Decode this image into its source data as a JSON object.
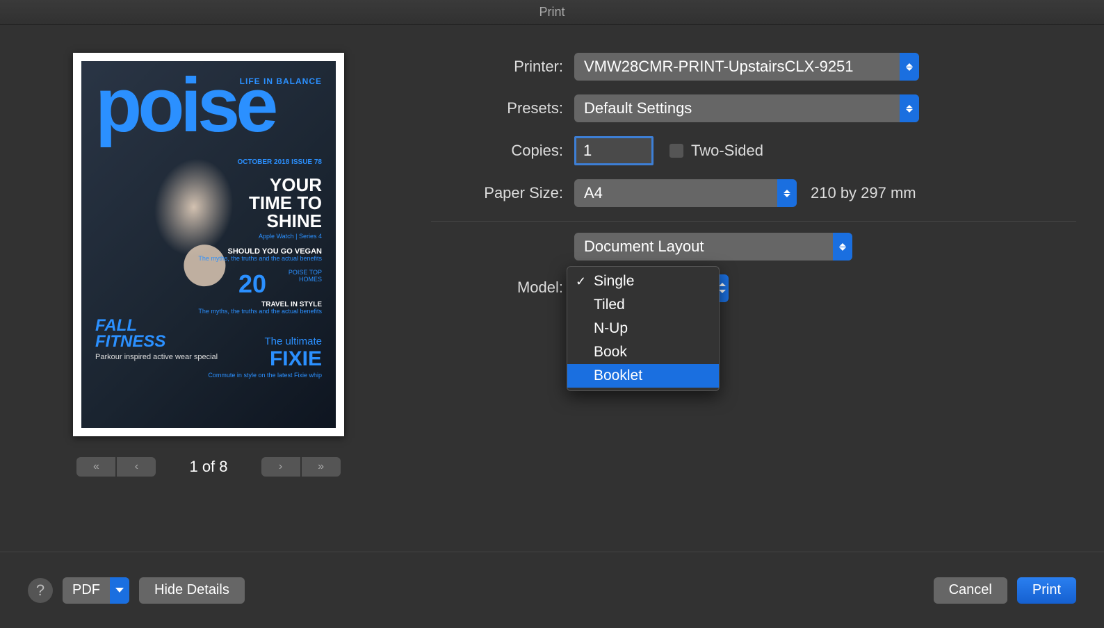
{
  "window": {
    "title": "Print"
  },
  "preview": {
    "page_indicator": "1 of 8",
    "cover": {
      "tagline": "LIFE IN BALANCE",
      "title": "poise",
      "issue": "OCTOBER 2018 ISSUE 78",
      "headline_l1": "YOUR",
      "headline_l2": "TIME TO",
      "headline_l3": "SHINE",
      "watch": "Apple Watch | Series 4",
      "vegan_h": "SHOULD YOU GO VEGAN",
      "vegan_s": "The myths, the truths and the actual benefits",
      "bignum": "20",
      "homes": "POISE TOP HOMES",
      "travel_h": "TRAVEL IN STYLE",
      "travel_s": "The myths, the truths and the actual benefits",
      "ultimate": "The ultimate",
      "fixie": "FIXIE",
      "fixie_s": "Commute in style on the latest Fixie whip",
      "fall_l1": "FALL",
      "fall_l2": "FITNESS",
      "fall_sub": "Parkour inspired active wear special"
    }
  },
  "labels": {
    "printer": "Printer:",
    "presets": "Presets:",
    "copies": "Copies:",
    "two_sided": "Two-Sided",
    "paper_size": "Paper Size:",
    "mode": "Model:"
  },
  "values": {
    "printer": "VMW28CMR-PRINT-UpstairsCLX-9251",
    "presets": "Default Settings",
    "copies": "1",
    "two_sided_checked": false,
    "paper_size": "A4",
    "paper_dim": "210 by 297 mm",
    "section": "Document Layout"
  },
  "mode_menu": {
    "options": [
      "Single",
      "Tiled",
      "N-Up",
      "Book",
      "Booklet"
    ],
    "selected": "Single",
    "highlighted": "Booklet"
  },
  "footer": {
    "pdf": "PDF",
    "hide_details": "Hide Details",
    "cancel": "Cancel",
    "print": "Print"
  }
}
